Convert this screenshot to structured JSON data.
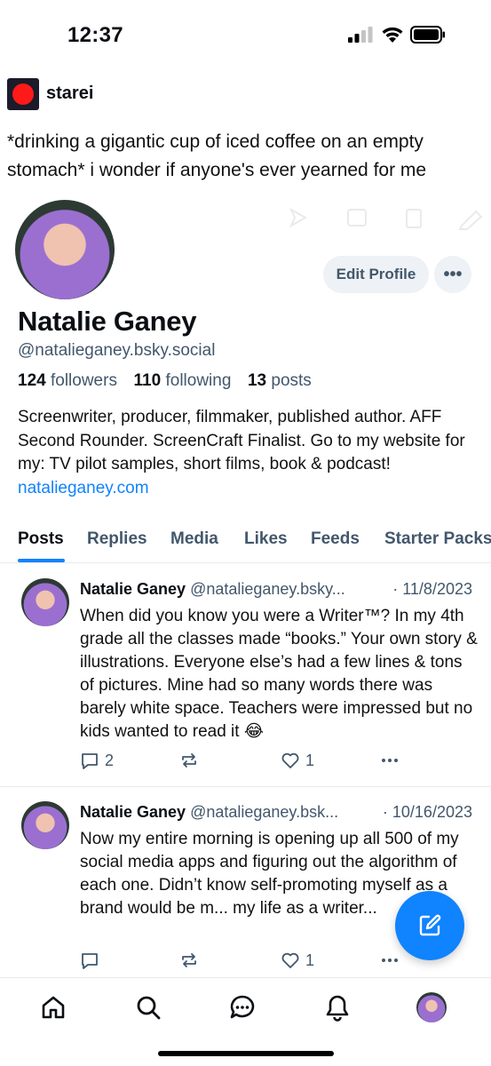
{
  "status_bar": {
    "time": "12:37"
  },
  "top_post": {
    "username": "starei",
    "text": "*drinking a gigantic cup of iced coffee on an empty stomach* i wonder if anyone's ever yearned for me"
  },
  "profile": {
    "display_name": "Natalie Ganey",
    "handle": "@natalieganey.bsky.social",
    "followers_count": "124",
    "followers_label": "followers",
    "following_count": "110",
    "following_label": "following",
    "posts_count": "13",
    "posts_label": "posts",
    "bio": "Screenwriter, producer, filmmaker, published author. AFF Second Rounder. ScreenCraft Finalist. Go to my website for my: TV pilot samples, short films, book & podcast! ",
    "website": "natalieganey.com",
    "edit_label": "Edit Profile",
    "more_label": "•••"
  },
  "tabs": [
    {
      "label": "Posts",
      "active": true
    },
    {
      "label": "Replies"
    },
    {
      "label": "Media"
    },
    {
      "label": "Likes"
    },
    {
      "label": "Feeds"
    },
    {
      "label": "Starter Packs"
    }
  ],
  "posts": [
    {
      "name": "Natalie Ganey",
      "handle": "@natalieganey.bsky...",
      "date": "· 11/8/2023",
      "text": "When did you know you were a Writer™? In my 4th grade all the classes made “books.” Your own story & illustrations. Everyone else’s had a few lines & tons of pictures. Mine had so many words there was barely white space. Teachers were impressed but no kids wanted to read it 😂",
      "replies": "2",
      "likes": "1"
    },
    {
      "name": "Natalie Ganey",
      "handle": "@natalieganey.bsk...",
      "date": "· 10/16/2023",
      "text": "Now my entire morning is opening up all 500 of my social media apps and figuring out the algorithm of each one. Didn’t know self-promoting myself as a brand would be m... my life as a writer...",
      "replies": "",
      "likes": "1"
    }
  ],
  "colors": {
    "accent": "#1083fe",
    "muted": "#42576c"
  },
  "icons": [
    "home-icon",
    "search-icon",
    "chat-icon",
    "bell-icon",
    "compose-icon",
    "reply-icon",
    "repost-icon",
    "like-icon",
    "more-icon"
  ]
}
